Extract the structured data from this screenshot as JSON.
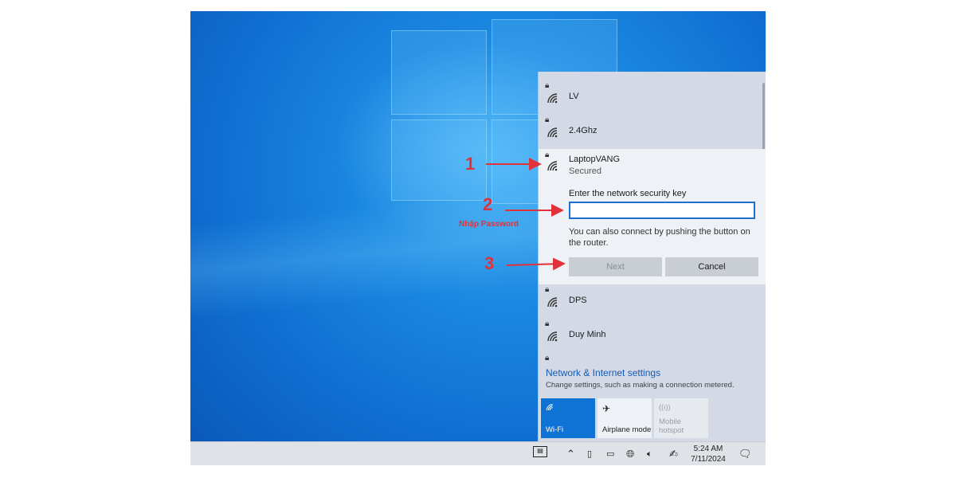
{
  "networks": [
    {
      "name": "LV"
    },
    {
      "name": "2.4Ghz"
    },
    {
      "name": "LaptopVANG",
      "status": "Secured"
    },
    {
      "name": "DPS"
    },
    {
      "name": "Duy Minh"
    }
  ],
  "connect_form": {
    "key_label": "Enter the network security key",
    "key_value": "",
    "router_hint": "You can also connect by pushing the button on the router.",
    "next_label": "Next",
    "cancel_label": "Cancel"
  },
  "settings": {
    "title": "Network & Internet settings",
    "description": "Change settings, such as making a connection metered."
  },
  "quick_actions": [
    {
      "label": "Wi-Fi",
      "icon": "wifi-icon",
      "active": true
    },
    {
      "label": "Airplane mode",
      "icon": "airplane-icon",
      "active": false
    },
    {
      "label": "Mobile hotspot",
      "icon": "hotspot-icon",
      "active": false,
      "disabled": true
    }
  ],
  "taskbar": {
    "time": "5:24 AM",
    "date": "7/11/2024"
  },
  "annotations": {
    "step1": "1",
    "step2": "2",
    "step2_note": "Nhập Password",
    "step3": "3",
    "color": "#e0323a"
  }
}
